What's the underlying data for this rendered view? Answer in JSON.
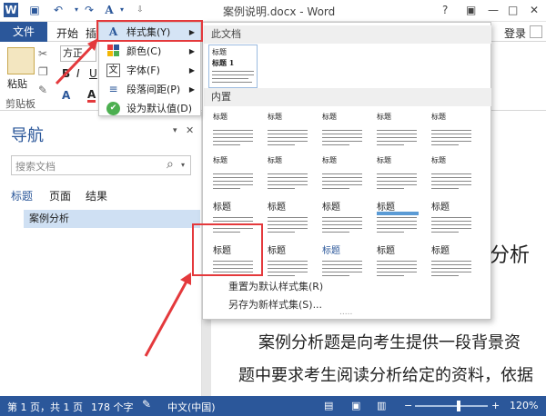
{
  "window": {
    "title": "案例说明.docx - Word",
    "help": "?",
    "restore": "□",
    "minimize": "—",
    "close": "✕"
  },
  "quick_access": {
    "app_icon": "W",
    "save": "💾",
    "undo": "↶",
    "redo": "↷",
    "design_icon": "A",
    "more": "▾"
  },
  "ribbon": {
    "tabs": [
      "文件",
      "开始",
      "插"
    ],
    "login": "登录",
    "font_name": "方正",
    "paste_label": "粘贴",
    "clipboard_label": "剪贴板",
    "bold": "B",
    "italic": "I",
    "underline": "U",
    "font_color": "A"
  },
  "dropdown": {
    "items": [
      {
        "label": "样式集(Y)",
        "icon": "style-set-icon",
        "glyph": "A",
        "submenu": true
      },
      {
        "label": "颜色(C)",
        "icon": "color-icon",
        "glyph": "■",
        "submenu": true
      },
      {
        "label": "字体(F)",
        "icon": "font-icon",
        "glyph": "文",
        "submenu": true
      },
      {
        "label": "段落间距(P)",
        "icon": "paragraph-spacing-icon",
        "glyph": "≡",
        "submenu": true
      },
      {
        "label": "设为默认值(D)",
        "icon": "check-circle-icon",
        "glyph": "✔",
        "submenu": false
      }
    ]
  },
  "gallery": {
    "section_this_doc": "此文档",
    "section_builtin": "内置",
    "thumb_title": "标题",
    "thumb_heading": "标题 1",
    "reset_label": "重置为默认样式集(R)",
    "save_label": "另存为新样式集(S)...",
    "resize_grip": "....."
  },
  "navigation": {
    "title": "导航",
    "close": "✕",
    "pin": "▾",
    "search_placeholder": "搜索文档",
    "search_icon": "search-icon",
    "search_glyph": "⌕",
    "tabs": [
      "标题",
      "页面",
      "结果"
    ],
    "items": [
      "案例分析"
    ]
  },
  "document": {
    "heading_partial": "分析",
    "body_line1": "案例分析题是向考生提供一段背景资",
    "body_line2": "题中要求考生阅读分析给定的资料，依据"
  },
  "status": {
    "page": "第 1 页，共 1 页",
    "words": "178 个字",
    "proof_icon": "proofing-icon",
    "language": "中文(中国)",
    "zoom": "120%",
    "zoom_minus": "−",
    "zoom_plus": "+",
    "zoom_level": 0.6
  },
  "colors": {
    "accent": "#2b579a",
    "highlight": "#e4393c",
    "nav_selected": "#cfe0f3"
  }
}
